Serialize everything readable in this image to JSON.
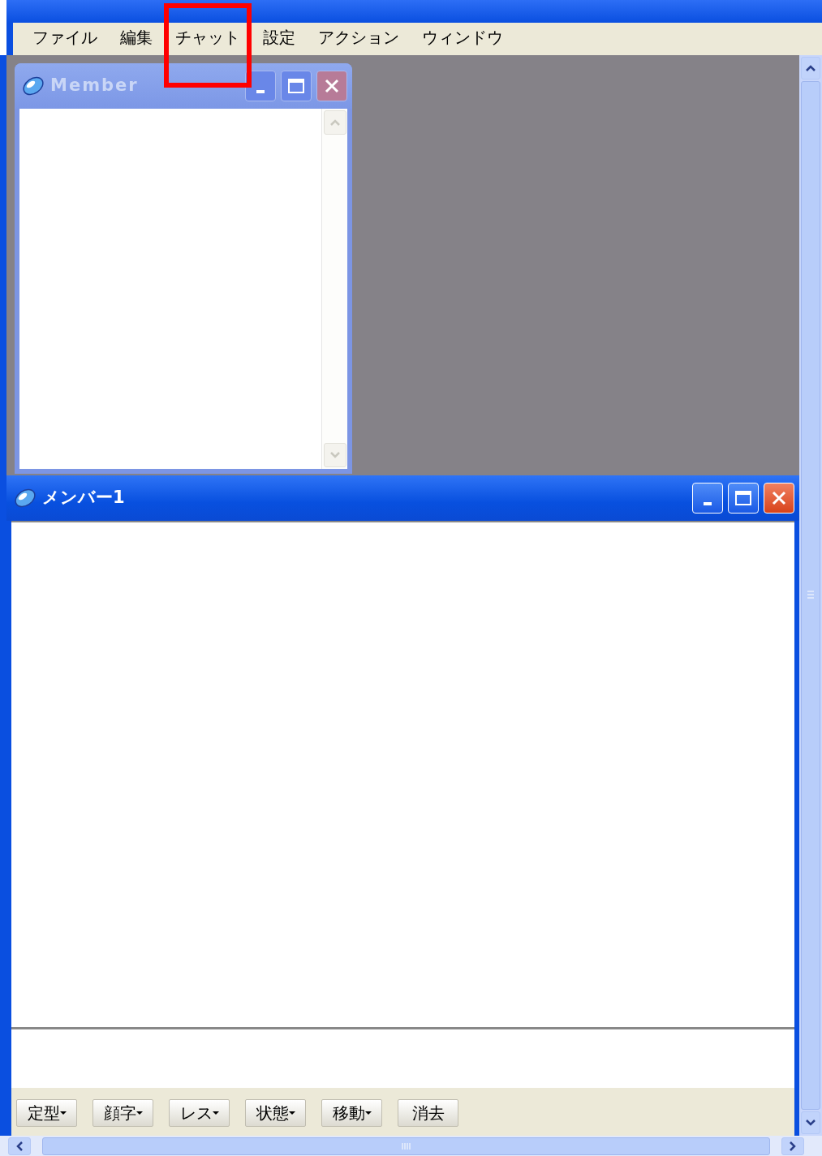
{
  "menu": [
    {
      "label": "ファイル",
      "highlighted": false
    },
    {
      "label": "編集",
      "highlighted": false
    },
    {
      "label": "チャット",
      "highlighted": true
    },
    {
      "label": "設定",
      "highlighted": false
    },
    {
      "label": "アクション",
      "highlighted": false
    },
    {
      "label": "ウィンドウ",
      "highlighted": false
    }
  ],
  "windows": [
    {
      "title": "Member",
      "active": false,
      "kind": "list"
    },
    {
      "title": "メンバー1",
      "active": true,
      "kind": "chat"
    }
  ],
  "chat_buttons": [
    {
      "label": "定型",
      "has_menu": true
    },
    {
      "label": "顔字",
      "has_menu": true
    },
    {
      "label": "レス",
      "has_menu": true
    },
    {
      "label": "状態",
      "has_menu": true
    },
    {
      "label": "移動",
      "has_menu": true
    },
    {
      "label": "消去",
      "has_menu": false
    }
  ]
}
